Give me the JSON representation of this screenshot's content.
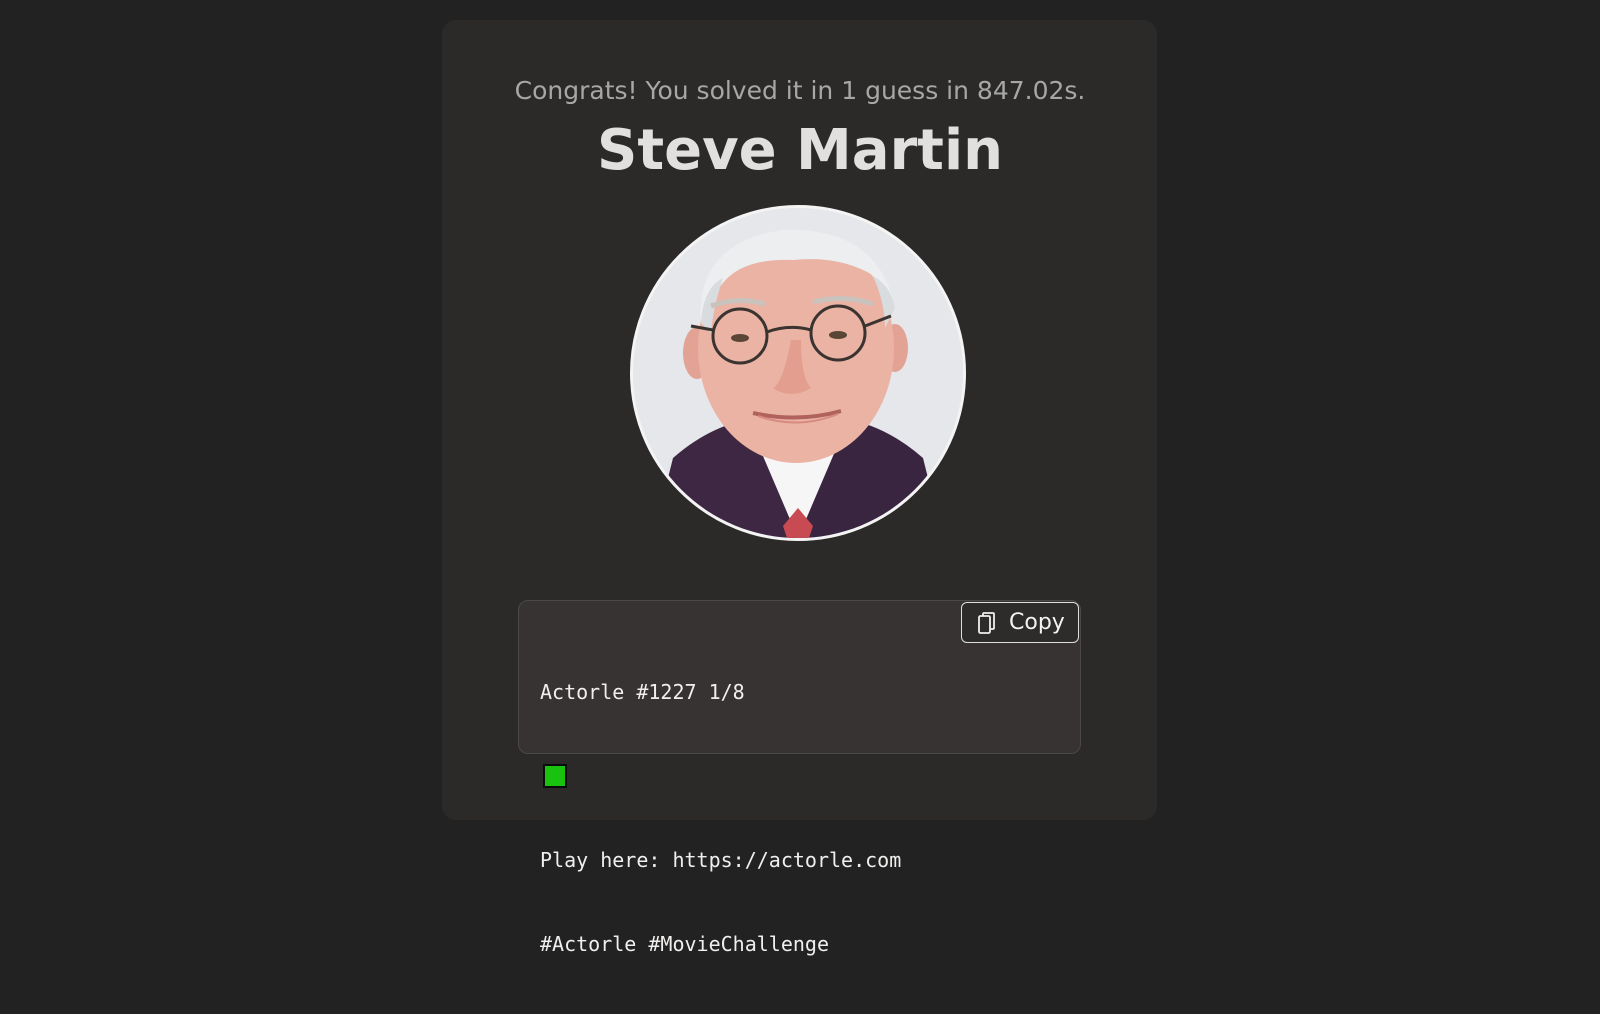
{
  "result": {
    "message": "Congrats! You solved it in 1 guess in 847.02s.",
    "actor_name": "Steve Martin"
  },
  "share": {
    "line1": "Actorle #1227 1/8",
    "guess_squares": [
      "correct"
    ],
    "line3": "Play here: https://actorle.com",
    "line4": "#Actorle #MovieChallenge",
    "correct_color": "#18c20f"
  },
  "copy_button": {
    "label": "Copy",
    "icon": "copy-icon"
  },
  "colors": {
    "page_background": "#232222",
    "card_background": "#2b2a29",
    "share_background": "#363332"
  }
}
